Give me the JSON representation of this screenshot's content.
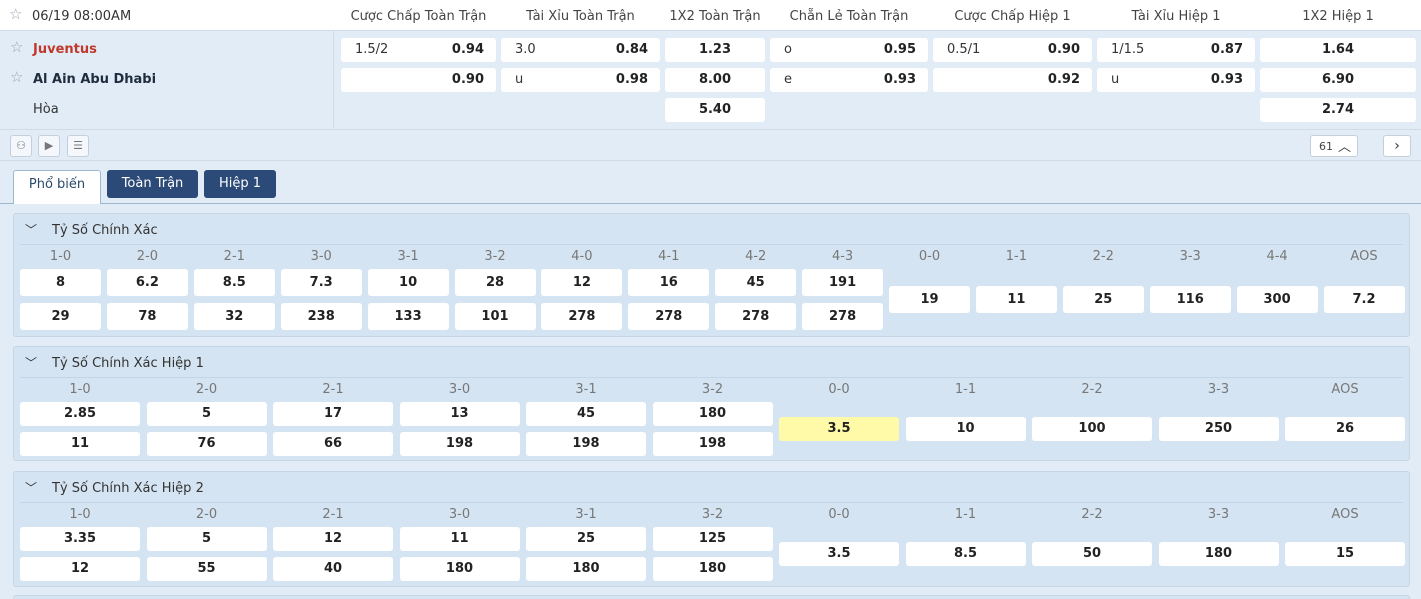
{
  "match": {
    "datetime": "06/19 08:00AM",
    "home": "Juventus",
    "away": "Al Ain Abu Dhabi",
    "draw": "Hòa"
  },
  "columns": [
    "Cược Chấp Toàn Trận",
    "Tài Xỉu Toàn Trận",
    "1X2 Toàn Trận",
    "Chẵn Lẻ Toàn Trận",
    "Cược Chấp Hiệp 1",
    "Tài Xỉu Hiệp 1",
    "1X2 Hiệp 1"
  ],
  "odds": {
    "ah_ft": {
      "home_line": "1.5/2",
      "home": "0.94",
      "away_line": "",
      "away": "0.90"
    },
    "ou_ft": {
      "over_line": "3.0",
      "over": "0.84",
      "under_line": "u",
      "under": "0.98"
    },
    "x12_ft": {
      "home": "1.23",
      "away": "8.00",
      "draw": "5.40"
    },
    "oe_ft": {
      "odd_label": "o",
      "odd": "0.95",
      "even_label": "e",
      "even": "0.93"
    },
    "ah_h1": {
      "home_line": "0.5/1",
      "home": "0.90",
      "away_line": "",
      "away": "0.92"
    },
    "ou_h1": {
      "over_line": "1/1.5",
      "over": "0.87",
      "under_line": "u",
      "under": "0.93"
    },
    "x12_h1": {
      "home": "1.64",
      "away": "6.90",
      "draw": "2.74"
    }
  },
  "toolbar": {
    "count": "61"
  },
  "tabs": [
    "Phổ biến",
    "Toàn Trận",
    "Hiệp 1"
  ],
  "sections": [
    {
      "title": "Tỷ Số Chính Xác",
      "labels": [
        "1-0",
        "2-0",
        "2-1",
        "3-0",
        "3-1",
        "3-2",
        "4-0",
        "4-1",
        "4-2",
        "4-3",
        "0-0",
        "1-1",
        "2-2",
        "3-3",
        "4-4",
        "AOS"
      ],
      "home": [
        "8",
        "6.2",
        "8.5",
        "7.3",
        "10",
        "28",
        "12",
        "16",
        "45",
        "191"
      ],
      "away": [
        "29",
        "78",
        "32",
        "238",
        "133",
        "101",
        "278",
        "278",
        "278",
        "278"
      ],
      "draw": [
        "19",
        "11",
        "25",
        "116",
        "300",
        "7.2"
      ]
    },
    {
      "title": "Tỷ Số Chính Xác Hiệp 1",
      "labels": [
        "1-0",
        "2-0",
        "2-1",
        "3-0",
        "3-1",
        "3-2",
        "0-0",
        "1-1",
        "2-2",
        "3-3",
        "AOS"
      ],
      "home": [
        "2.85",
        "5",
        "17",
        "13",
        "45",
        "180"
      ],
      "away": [
        "11",
        "76",
        "66",
        "198",
        "198",
        "198"
      ],
      "draw": [
        "3.5",
        "10",
        "100",
        "250",
        "26"
      ]
    },
    {
      "title": "Tỷ Số Chính Xác Hiệp 2",
      "labels": [
        "1-0",
        "2-0",
        "2-1",
        "3-0",
        "3-1",
        "3-2",
        "0-0",
        "1-1",
        "2-2",
        "3-3",
        "AOS"
      ],
      "home": [
        "3.35",
        "5",
        "12",
        "11",
        "25",
        "125"
      ],
      "away": [
        "12",
        "55",
        "40",
        "180",
        "180",
        "180"
      ],
      "draw": [
        "3.5",
        "8.5",
        "50",
        "180",
        "15"
      ]
    }
  ]
}
